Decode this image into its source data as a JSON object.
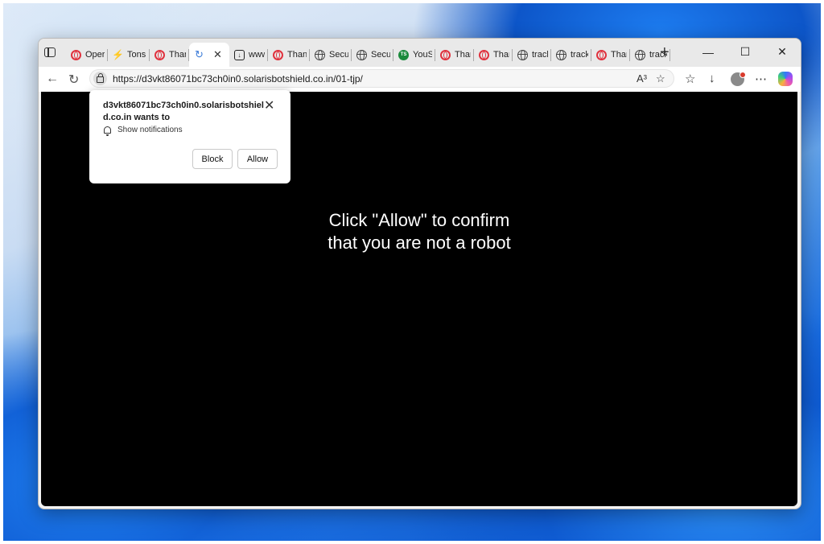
{
  "browser": {
    "tabs": [
      {
        "label": "Oper",
        "icon": "opera-icon"
      },
      {
        "label": "Tons",
        "icon": "lightning-icon"
      },
      {
        "label": "Than",
        "icon": "opera-icon"
      },
      {
        "label": "",
        "icon": "sync-icon",
        "active": true,
        "close": "✕"
      },
      {
        "label": "www",
        "icon": "download-icon"
      },
      {
        "label": "Than",
        "icon": "opera-icon"
      },
      {
        "label": "Secu",
        "icon": "globe-icon"
      },
      {
        "label": "Secu",
        "icon": "globe-icon"
      },
      {
        "label": "YouS",
        "icon": "ts-icon",
        "icon_text": "TS"
      },
      {
        "label": "Than",
        "icon": "opera-icon"
      },
      {
        "label": "Than",
        "icon": "opera-icon"
      },
      {
        "label": "track",
        "icon": "globe-icon"
      },
      {
        "label": "track",
        "icon": "globe-icon"
      },
      {
        "label": "Than",
        "icon": "opera-icon"
      },
      {
        "label": "track",
        "icon": "globe-icon"
      }
    ],
    "new_tab": "+",
    "window_controls": {
      "minimize": "—",
      "maximize": "☐",
      "close": "✕"
    },
    "address_bar": {
      "url": "https://d3vkt86071bc73ch0in0.solarisbotshield.co.in/01-tjp/"
    },
    "nav": {
      "back": "←",
      "refresh": "↻"
    },
    "toolbar": {
      "read_aloud": "A³",
      "favorite": "☆",
      "favorites": "☆",
      "downloads": "↓",
      "more": "⋯"
    }
  },
  "permission_popup": {
    "site": "d3vkt86071bc73ch0in0.solarisbotshield.co.in wants to",
    "close": "✕",
    "permission": "Show notifications",
    "block_label": "Block",
    "allow_label": "Allow"
  },
  "page": {
    "message_line1": "Click \"Allow\" to confirm",
    "message_line2": "that you are not a robot"
  }
}
